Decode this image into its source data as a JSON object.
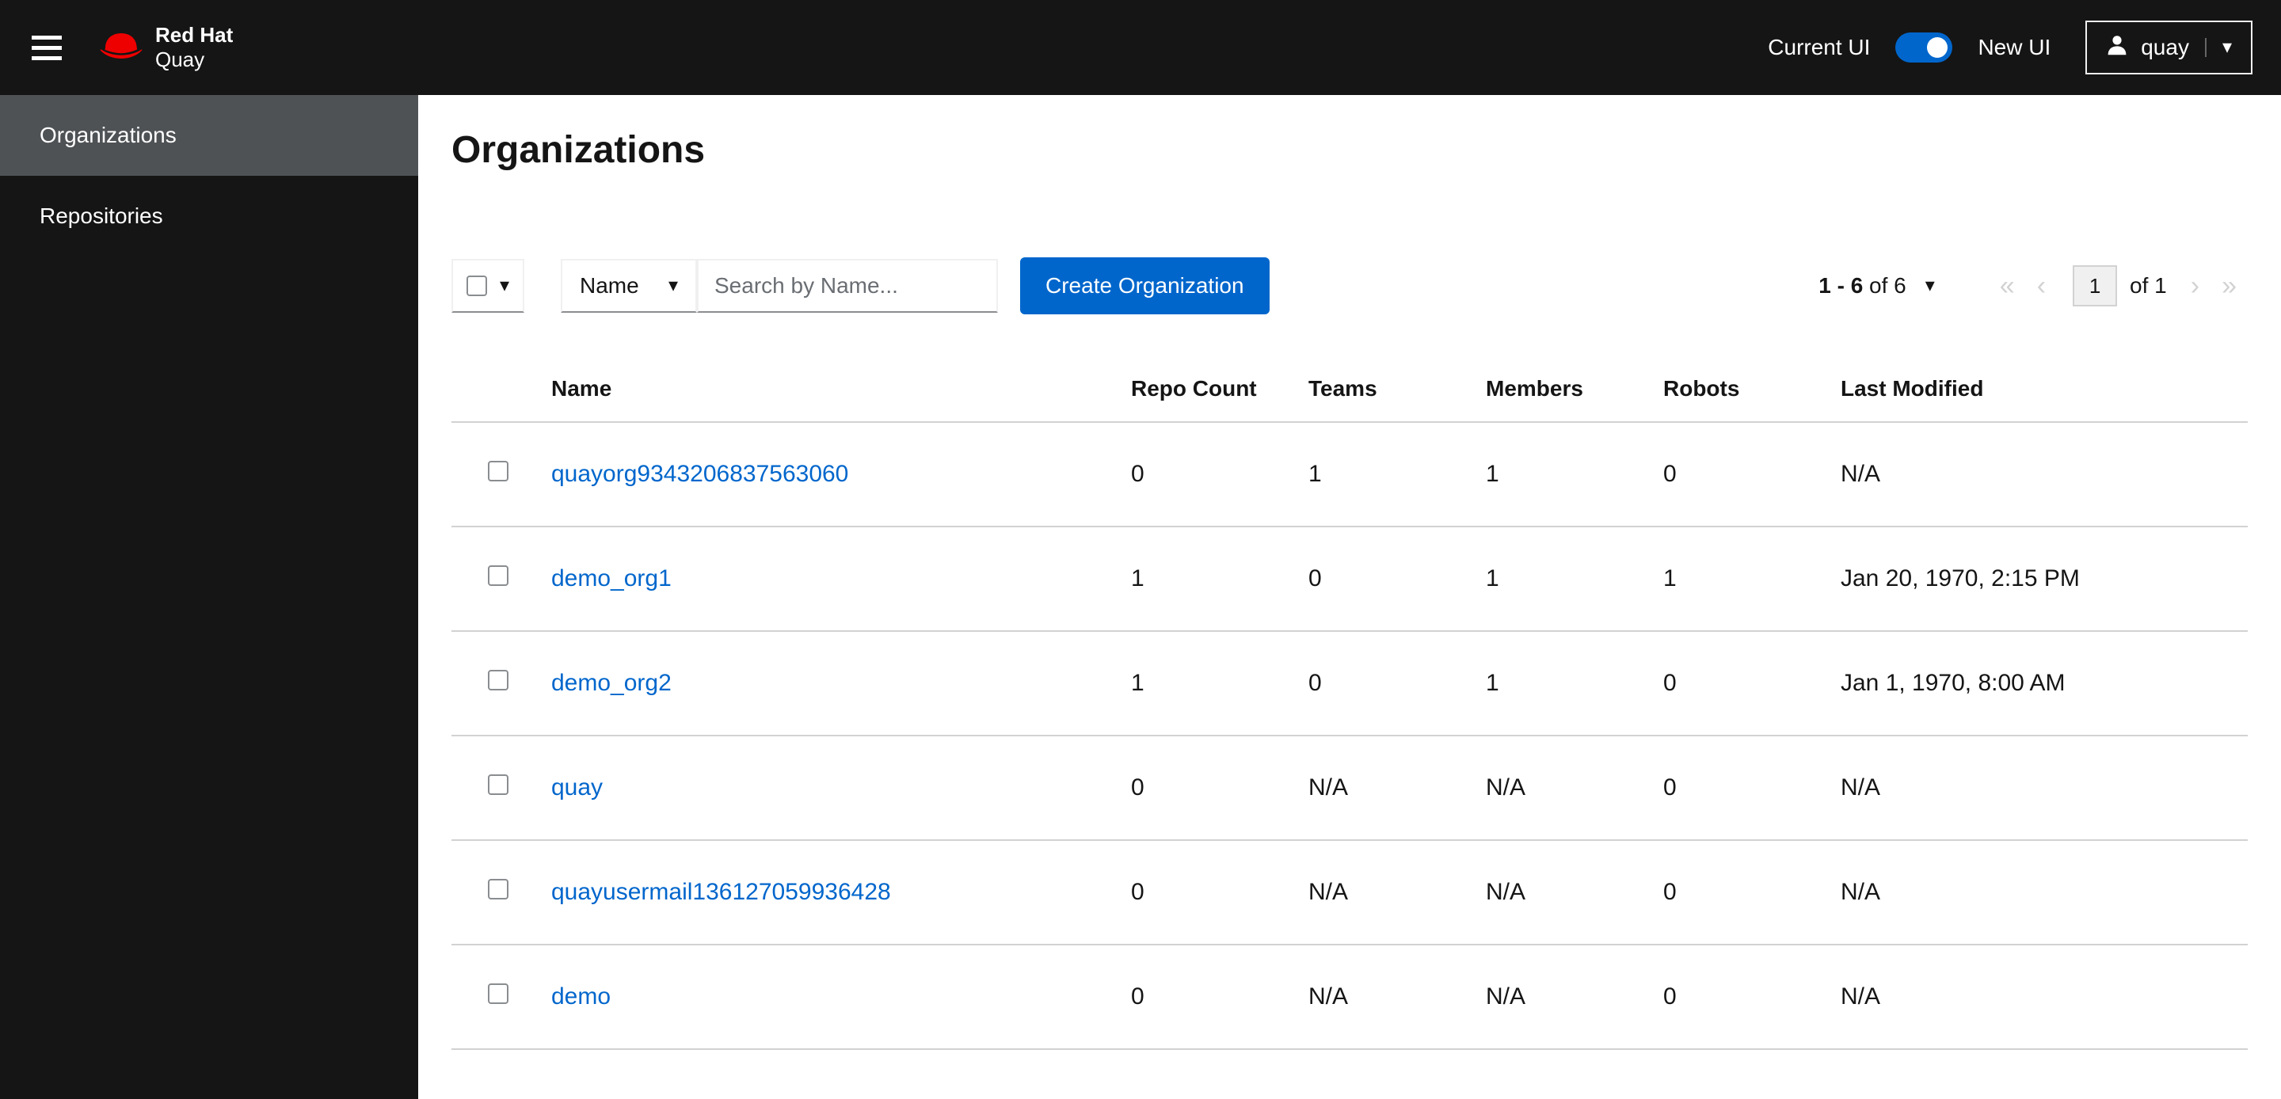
{
  "header": {
    "brand": {
      "line1": "Red Hat",
      "line2": "Quay"
    },
    "ui_toggle": {
      "left_label": "Current UI",
      "right_label": "New UI",
      "checked": true
    },
    "user_menu": {
      "label": "quay"
    }
  },
  "sidebar": {
    "items": [
      {
        "label": "Organizations",
        "active": true
      },
      {
        "label": "Repositories",
        "active": false
      }
    ]
  },
  "main": {
    "title": "Organizations",
    "toolbar": {
      "filter_dropdown": "Name",
      "search_placeholder": "Search by Name...",
      "create_button": "Create Organization",
      "pagination": {
        "range": "1 - 6",
        "of_total": "of 6",
        "page": "1",
        "of_label": "of 1"
      }
    },
    "table": {
      "columns": [
        "Name",
        "Repo Count",
        "Teams",
        "Members",
        "Robots",
        "Last Modified"
      ],
      "rows": [
        {
          "name": "quayorg9343206837563060",
          "repo_count": "0",
          "teams": "1",
          "members": "1",
          "robots": "0",
          "last_modified": "N/A"
        },
        {
          "name": "demo_org1",
          "repo_count": "1",
          "teams": "0",
          "members": "1",
          "robots": "1",
          "last_modified": "Jan 20, 1970, 2:15 PM"
        },
        {
          "name": "demo_org2",
          "repo_count": "1",
          "teams": "0",
          "members": "1",
          "robots": "0",
          "last_modified": "Jan 1, 1970, 8:00 AM"
        },
        {
          "name": "quay",
          "repo_count": "0",
          "teams": "N/A",
          "members": "N/A",
          "robots": "0",
          "last_modified": "N/A"
        },
        {
          "name": "quayusermail136127059936428",
          "repo_count": "0",
          "teams": "N/A",
          "members": "N/A",
          "robots": "0",
          "last_modified": "N/A"
        },
        {
          "name": "demo",
          "repo_count": "0",
          "teams": "N/A",
          "members": "N/A",
          "robots": "0",
          "last_modified": "N/A"
        }
      ]
    }
  },
  "icons": {
    "caret_down": "▾",
    "first_page": "«",
    "prev_page": "‹",
    "next_page": "›",
    "last_page": "»"
  },
  "colors": {
    "primary_blue": "#0066cc",
    "link_blue": "#0066cc",
    "masthead_bg": "#151515",
    "sidebar_bg": "#151515",
    "sidebar_active_bg": "#4f5255",
    "brand_red": "#ee0000",
    "row_border": "#d2d2d2",
    "disabled_gray": "#d2d2d2",
    "text_dark": "#151515"
  }
}
